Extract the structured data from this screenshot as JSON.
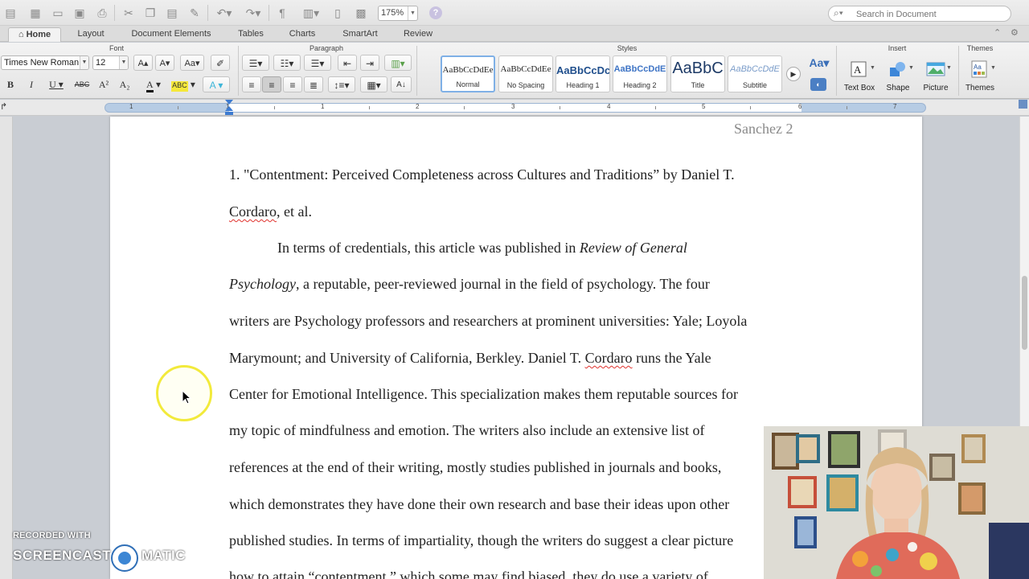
{
  "toolbar": {
    "zoom": "175%",
    "search_placeholder": "Search in Document"
  },
  "tabs": [
    {
      "label": "Home"
    },
    {
      "label": "Layout"
    },
    {
      "label": "Document Elements"
    },
    {
      "label": "Tables"
    },
    {
      "label": "Charts"
    },
    {
      "label": "SmartArt"
    },
    {
      "label": "Review"
    }
  ],
  "ribbon": {
    "groups": {
      "font": "Font",
      "paragraph": "Paragraph",
      "styles": "Styles",
      "insert": "Insert",
      "themes": "Themes"
    },
    "font_name": "Times New Roman",
    "font_size": "12",
    "styles": [
      {
        "preview": "AaBbCcDdEe",
        "name": "Normal"
      },
      {
        "preview": "AaBbCcDdEe",
        "name": "No Spacing"
      },
      {
        "preview": "AaBbCcDc",
        "name": "Heading 1"
      },
      {
        "preview": "AaBbCcDdE",
        "name": "Heading 2"
      },
      {
        "preview": "AaBbC",
        "name": "Title"
      },
      {
        "preview": "AaBbCcDdE",
        "name": "Subtitle"
      }
    ],
    "insert": {
      "text_box": "Text Box",
      "shape": "Shape",
      "picture": "Picture"
    },
    "themes_label": "Themes"
  },
  "ruler": {
    "numbers": [
      "1",
      "1",
      "1",
      "2",
      "3",
      "4",
      "5",
      "6",
      "7"
    ]
  },
  "document": {
    "header": "Sanchez 2",
    "lines": [
      {
        "text": "1. \"Contentment: Perceived Completeness across Cultures and Traditions” by Daniel T."
      },
      {
        "a": "Cordaro",
        "b": ", et al."
      },
      {
        "text": "In terms of credentials, this article was published in ",
        "i": "Review of General"
      },
      {
        "i": "Psychology",
        "text": ", a reputable, peer-reviewed journal in the field of psychology. The four"
      },
      {
        "text": "writers are Psychology professors and researchers at prominent universities: Yale; Loyola"
      },
      {
        "a": "Marymount; and University of California, Berkley. Daniel T. ",
        "sq": "Cordaro",
        "b": " runs the Yale"
      },
      {
        "text": "Center for Emotional Intelligence. This specialization makes them reputable sources for"
      },
      {
        "text": "my topic of mindfulness and emotion. The writers also include an extensive list of"
      },
      {
        "text": "references at the end of their writing, mostly studies published in journals and books,"
      },
      {
        "text": "which demonstrates they have done their own research and base their ideas upon other"
      },
      {
        "text": "published studies. In terms of impartiality, though the writers do suggest a clear picture"
      },
      {
        "text": "how to attain “contentment,” which some may find biased, they do use a variety of"
      }
    ]
  },
  "watermark": {
    "recorded": "RECORDED WITH",
    "screencast": "SCREENCAST",
    "matic": "MATIC"
  }
}
